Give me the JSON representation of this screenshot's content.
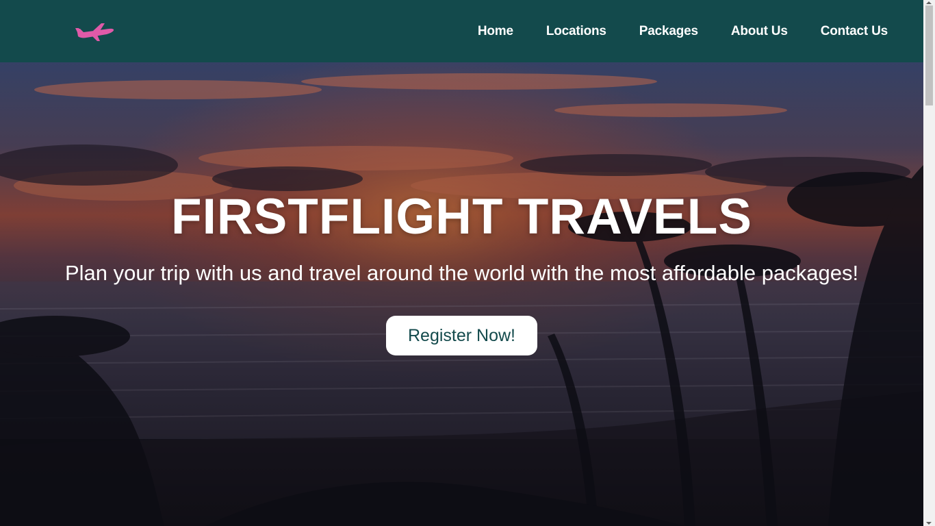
{
  "nav": {
    "logo_icon": "airplane-icon",
    "logo_color": "#e05aa8",
    "background": "#134a4c",
    "links": [
      {
        "label": "Home"
      },
      {
        "label": "Locations"
      },
      {
        "label": "Packages"
      },
      {
        "label": "About Us"
      },
      {
        "label": "Contact Us"
      }
    ]
  },
  "hero": {
    "background_description_color_top": "#3f4a72",
    "title": "FIRSTFLIGHT TRAVELS",
    "subtitle": "Plan your trip with us and travel around the world with the most affordable packages!",
    "cta_label": "Register Now!",
    "cta_text_color": "#134a4c"
  }
}
